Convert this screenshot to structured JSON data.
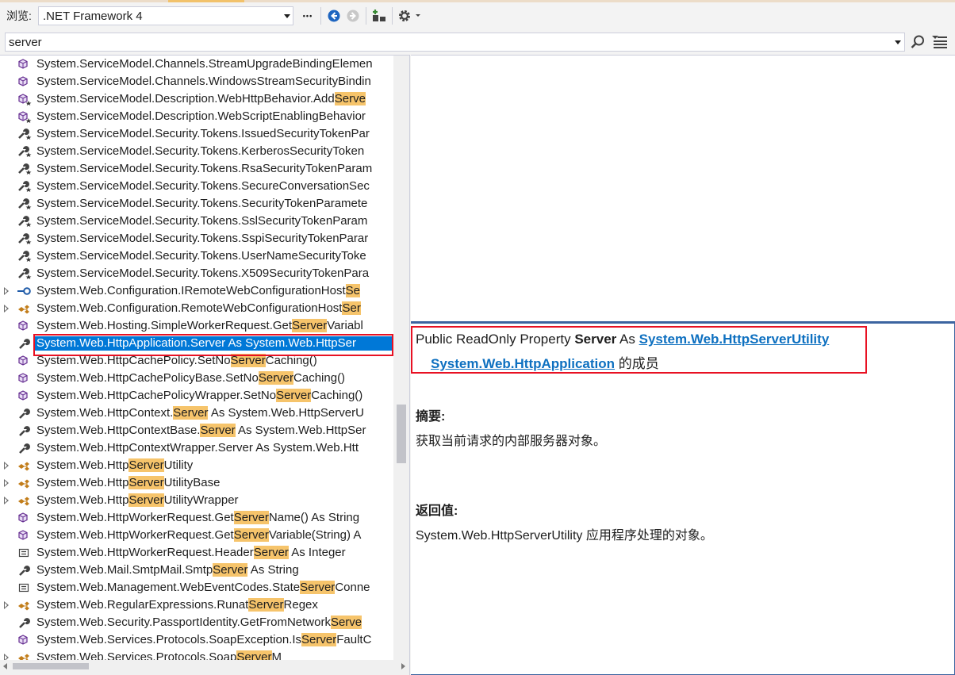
{
  "toolbar": {
    "browse_label": "浏览:",
    "framework": ".NET Framework 4",
    "more_label": "•••"
  },
  "search": {
    "value": "server"
  },
  "tree": {
    "rows": [
      {
        "text": "System.ServiceModel.Channels.StreamUpgradeBindingElemen",
        "icon": "method-icon",
        "expand": false,
        "hl": ""
      },
      {
        "text": "System.ServiceModel.Channels.WindowsStreamSecurityBindin",
        "icon": "method-icon",
        "expand": false,
        "hl": ""
      },
      {
        "text": "System.ServiceModel.Description.WebHttpBehavior.AddServe",
        "icon": "protected-method-icon",
        "expand": false,
        "hl": "Serve"
      },
      {
        "text": "System.ServiceModel.Description.WebScriptEnablingBehavior",
        "icon": "protected-method-icon",
        "expand": false,
        "hl": ""
      },
      {
        "text": "System.ServiceModel.Security.Tokens.IssuedSecurityTokenPar",
        "icon": "protected-property-icon",
        "expand": false,
        "hl": ""
      },
      {
        "text": "System.ServiceModel.Security.Tokens.KerberosSecurityToken",
        "icon": "protected-property-icon",
        "expand": false,
        "hl": ""
      },
      {
        "text": "System.ServiceModel.Security.Tokens.RsaSecurityTokenParam",
        "icon": "protected-property-icon",
        "expand": false,
        "hl": ""
      },
      {
        "text": "System.ServiceModel.Security.Tokens.SecureConversationSec",
        "icon": "protected-property-icon",
        "expand": false,
        "hl": ""
      },
      {
        "text": "System.ServiceModel.Security.Tokens.SecurityTokenParamete",
        "icon": "protected-property-icon",
        "expand": false,
        "hl": ""
      },
      {
        "text": "System.ServiceModel.Security.Tokens.SslSecurityTokenParam",
        "icon": "protected-property-icon",
        "expand": false,
        "hl": ""
      },
      {
        "text": "System.ServiceModel.Security.Tokens.SspiSecurityTokenParar",
        "icon": "protected-property-icon",
        "expand": false,
        "hl": ""
      },
      {
        "text": "System.ServiceModel.Security.Tokens.UserNameSecurityToke",
        "icon": "protected-property-icon",
        "expand": false,
        "hl": ""
      },
      {
        "text": "System.ServiceModel.Security.Tokens.X509SecurityTokenPara",
        "icon": "protected-property-icon",
        "expand": false,
        "hl": ""
      },
      {
        "text": "System.Web.Configuration.IRemoteWebConfigurationHostSe",
        "icon": "interface-icon",
        "expand": true,
        "hl": "Se"
      },
      {
        "text": "System.Web.Configuration.RemoteWebConfigurationHostSer",
        "icon": "class-icon",
        "expand": true,
        "hl": "Ser"
      },
      {
        "text": "System.Web.Hosting.SimpleWorkerRequest.GetServerVariabl",
        "icon": "method-icon",
        "expand": false,
        "hl": "Server"
      },
      {
        "text": "System.Web.HttpApplication.Server As System.Web.HttpSer",
        "icon": "property-icon",
        "expand": false,
        "hl": "Server",
        "selected": true
      },
      {
        "text": "System.Web.HttpCachePolicy.SetNoServerCaching()",
        "icon": "method-icon",
        "expand": false,
        "hl": "Server"
      },
      {
        "text": "System.Web.HttpCachePolicyBase.SetNoServerCaching()",
        "icon": "method-icon",
        "expand": false,
        "hl": "Server"
      },
      {
        "text": "System.Web.HttpCachePolicyWrapper.SetNoServerCaching()",
        "icon": "method-icon",
        "expand": false,
        "hl": "Server"
      },
      {
        "text": "System.Web.HttpContext.Server As System.Web.HttpServerU",
        "icon": "property-icon",
        "expand": false,
        "hl": "Server"
      },
      {
        "text": "System.Web.HttpContextBase.Server As System.Web.HttpSer",
        "icon": "property-icon",
        "expand": false,
        "hl": "Server"
      },
      {
        "text": "System.Web.HttpContextWrapper.Server As System.Web.Htt",
        "icon": "property-icon",
        "expand": false,
        "hl": ""
      },
      {
        "text": "System.Web.HttpServerUtility",
        "icon": "class-icon",
        "expand": true,
        "hl": "Server"
      },
      {
        "text": "System.Web.HttpServerUtilityBase",
        "icon": "class-icon",
        "expand": true,
        "hl": "Server"
      },
      {
        "text": "System.Web.HttpServerUtilityWrapper",
        "icon": "class-icon",
        "expand": true,
        "hl": "Server"
      },
      {
        "text": "System.Web.HttpWorkerRequest.GetServerName() As String",
        "icon": "method-icon",
        "expand": false,
        "hl": "Server"
      },
      {
        "text": "System.Web.HttpWorkerRequest.GetServerVariable(String) A",
        "icon": "method-icon",
        "expand": false,
        "hl": "Server"
      },
      {
        "text": "System.Web.HttpWorkerRequest.HeaderServer As Integer",
        "icon": "field-icon",
        "expand": false,
        "hl": "Server"
      },
      {
        "text": "System.Web.Mail.SmtpMail.SmtpServer As String",
        "icon": "property-icon",
        "expand": false,
        "hl": "Server"
      },
      {
        "text": "System.Web.Management.WebEventCodes.StateServerConne",
        "icon": "field-icon",
        "expand": false,
        "hl": "Server"
      },
      {
        "text": "System.Web.RegularExpressions.RunatServerRegex",
        "icon": "class-icon",
        "expand": true,
        "hl": "Server"
      },
      {
        "text": "System.Web.Security.PassportIdentity.GetFromNetworkServe",
        "icon": "property-icon",
        "expand": false,
        "hl": "Serve"
      },
      {
        "text": "System.Web.Services.Protocols.SoapException.IsServerFaultC",
        "icon": "method-icon",
        "expand": false,
        "hl": "Server"
      },
      {
        "text": "System.Web.Services.Protocols.SoapServerM",
        "icon": "class-icon",
        "expand": true,
        "hl": "Server"
      }
    ]
  },
  "details": {
    "sig_prefix": "Public ReadOnly Property ",
    "sig_name": "Server",
    "sig_as": " As ",
    "sig_type": "System.Web.HttpServerUtility",
    "owner_link": "System.Web.HttpApplication",
    "owner_suffix": " 的成员",
    "summary_head": "摘要:",
    "summary_text": "获取当前请求的内部服务器对象。",
    "returns_head": "返回值:",
    "returns_text": "System.Web.HttpServerUtility 应用程序处理的对象。"
  },
  "colors": {
    "selection": "#0078d7",
    "highlight": "#f6c46b",
    "link": "#0e70c0",
    "annotation": "#e81123"
  }
}
